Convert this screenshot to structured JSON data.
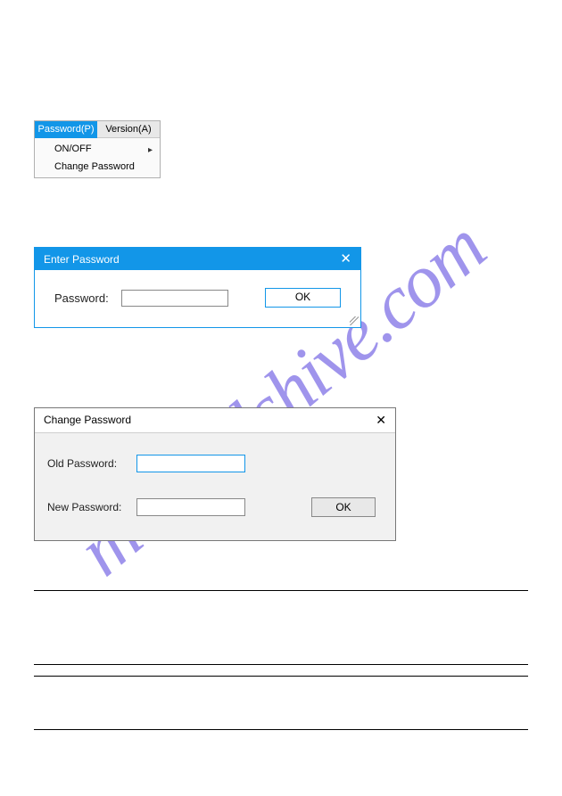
{
  "watermark": "manualshive.com",
  "menu": {
    "tabs": [
      {
        "label": "Password(P)",
        "active": true
      },
      {
        "label": "Version(A)",
        "active": false
      }
    ],
    "items": [
      {
        "label": "ON/OFF",
        "hasSubmenu": true
      },
      {
        "label": "Change Password",
        "hasSubmenu": false
      }
    ]
  },
  "dialog_enter": {
    "title": "Enter Password",
    "close_glyph": "✕",
    "label": "Password:",
    "ok_label": "OK"
  },
  "dialog_change": {
    "title": "Change Password",
    "close_glyph": "✕",
    "old_label": "Old Password:",
    "new_label": "New Password:",
    "ok_label": "OK"
  }
}
